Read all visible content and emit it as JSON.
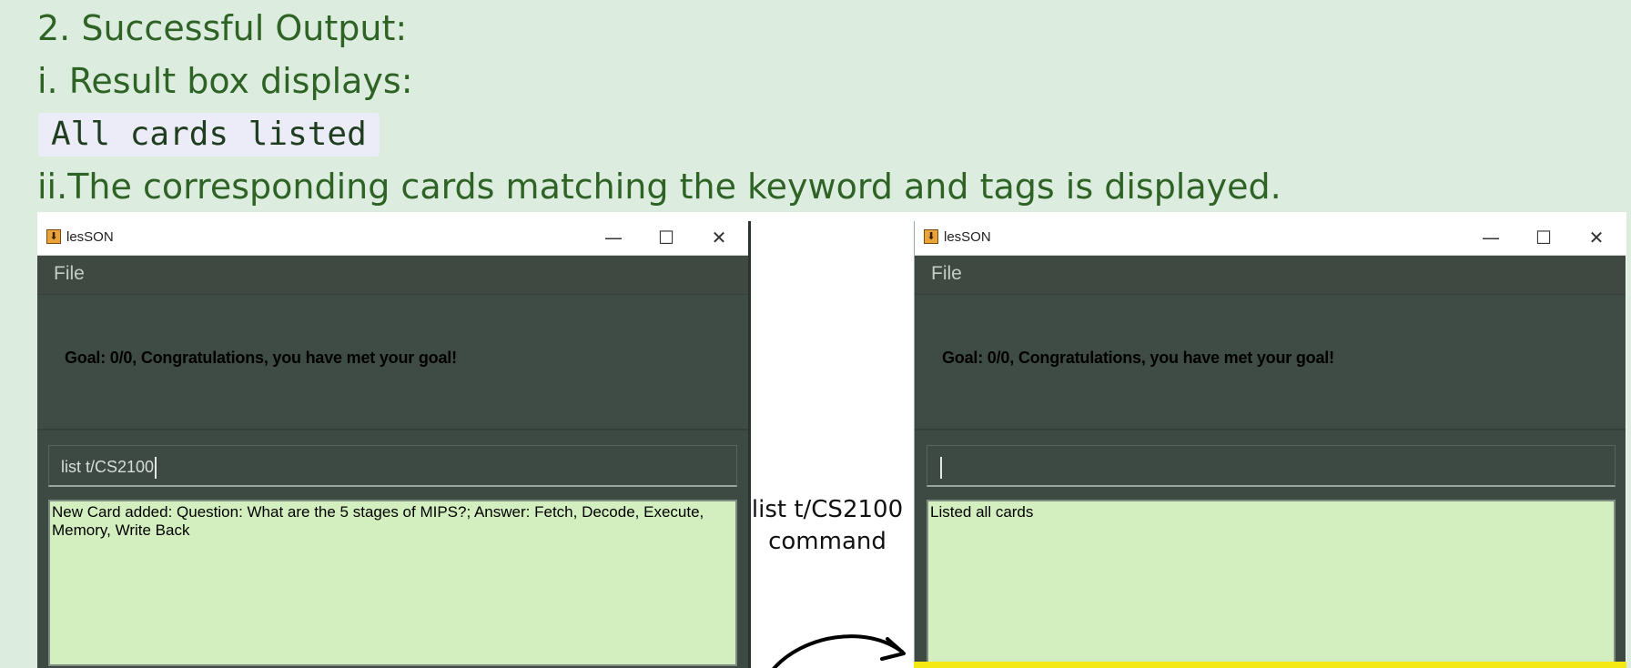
{
  "doc": {
    "step_heading": "2. Successful Output:",
    "result_line": "i. Result box displays:",
    "result_code": "All cards listed",
    "cards_line": "ii.The corresponding cards matching the keyword and tags is displayed."
  },
  "windows": {
    "left": {
      "title": "lesSON",
      "menu_file": "File",
      "goal": "Goal: 0/0, Congratulations, you have met your goal!",
      "command_value": "list t/CS2100",
      "result": "New Card added: Question: What are the 5 stages of MIPS?; Answer: Fetch, Decode, Execute, Memory, Write Back"
    },
    "right": {
      "title": "lesSON",
      "menu_file": "File",
      "goal": "Goal: 0/0, Congratulations, you have met your goal!",
      "command_value": "",
      "result": "Listed all cards"
    }
  },
  "window_controls": {
    "minimize": "—",
    "maximize": "☐",
    "close": "✕"
  },
  "arrow_label": {
    "line1": "list t/CS2100",
    "line2": "command"
  },
  "icons": {
    "app": "java-app-icon",
    "arrow": "curved-arrow-right-icon"
  },
  "colors": {
    "page_bg": "#dcede0",
    "doc_text": "#2e6325",
    "window_bg": "#3d4a43",
    "result_bg": "#d3efbf",
    "highlight_strip": "#f5e914"
  }
}
